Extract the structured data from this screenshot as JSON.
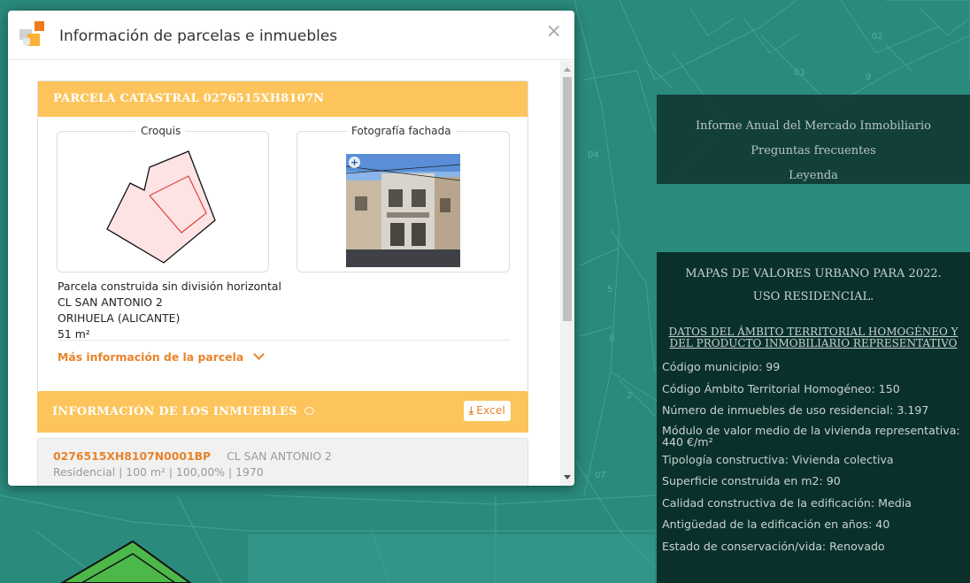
{
  "modal": {
    "title": "Información de parcelas e inmuebles",
    "close_glyph": "×"
  },
  "parcel": {
    "header": "PARCELA CATASTRAL 0276515XH8107N",
    "croquis_label": "Croquis",
    "foto_label": "Fotografía fachada",
    "zoom_glyph": "+",
    "type": "Parcela construida sin división horizontal",
    "address": "CL SAN ANTONIO 2",
    "city": "ORIHUELA (ALICANTE)",
    "area": "51 m²",
    "more_info": "Más información de la parcela"
  },
  "inmuebles": {
    "header": "INFORMACIÓN DE LOS INMUEBLES",
    "excel_label": "Excel",
    "items": [
      {
        "ref": "0276515XH8107N0001BP",
        "address": "CL SAN ANTONIO 2",
        "details": "Residencial | 100 m² | 100,00% | 1970"
      }
    ]
  },
  "links": [
    "Informe Anual del Mercado Inmobiliario",
    "Preguntas frecuentes",
    "Leyenda"
  ],
  "values_panel": {
    "title1": "MAPAS DE VALORES URBANO PARA 2022.",
    "title2": "USO RESIDENCIAL.",
    "subtitle": "DATOS DEL ÁMBITO TERRITORIAL HOMOGÉNEO Y DEL PRODUCTO INMOBILIARIO REPRESENTATIVO",
    "rows": [
      "Código municipio: 99",
      "Código Ámbito Territorial Homogéneo: 150",
      "Número de inmuebles de uso residencial: 3.197",
      "Módulo de valor medio de la vivienda representativa: 440 €/m²",
      "Tipología constructiva: Vivienda colectiva",
      "Superficie construida en m2: 90",
      "Calidad constructiva de la edificación: Media",
      "Antigüedad de la edificación en años: 40",
      "Estado de conservación/vida: Renovado"
    ]
  },
  "map_labels": [
    "02",
    "03",
    "9",
    "04",
    "07",
    "2",
    "5",
    "8"
  ],
  "colors": {
    "map_bg": "#2a8a7c",
    "header_orange": "#fcc45a",
    "link_orange": "#e8832a"
  }
}
